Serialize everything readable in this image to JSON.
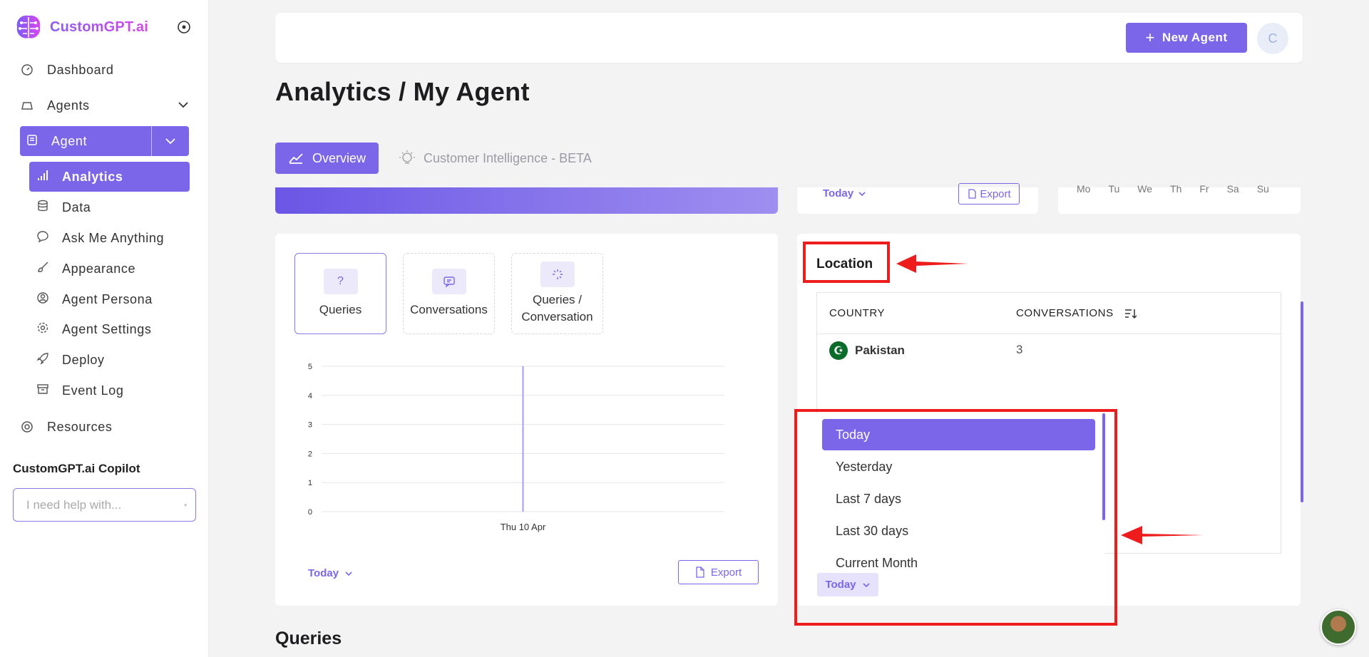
{
  "app": {
    "name": "CustomGPT.ai"
  },
  "sidebar": {
    "items": [
      {
        "label": "Dashboard",
        "icon": "dashboard-icon"
      },
      {
        "label": "Agents",
        "icon": "agents-icon"
      },
      {
        "label": "Agent",
        "icon": "agent-icon"
      },
      {
        "label": "Resources",
        "icon": "lifebuoy-icon"
      }
    ],
    "sub_items": [
      {
        "label": "Analytics",
        "icon": "bar-chart-icon"
      },
      {
        "label": "Data",
        "icon": "database-icon"
      },
      {
        "label": "Ask Me Anything",
        "icon": "chat-icon"
      },
      {
        "label": "Appearance",
        "icon": "brush-icon"
      },
      {
        "label": "Agent Persona",
        "icon": "user-circle-icon"
      },
      {
        "label": "Agent Settings",
        "icon": "gear-icon"
      },
      {
        "label": "Deploy",
        "icon": "rocket-icon"
      },
      {
        "label": "Event Log",
        "icon": "archive-icon"
      }
    ],
    "copilot": {
      "title": "CustomGPT.ai Copilot",
      "placeholder": "I need help with..."
    }
  },
  "header": {
    "new_agent_label": "New Agent",
    "avatar_initial": "C"
  },
  "page": {
    "title": "Analytics / My Agent"
  },
  "tabs": [
    {
      "label": "Overview",
      "active": true
    },
    {
      "label": "Customer Intelligence - BETA",
      "active": false
    }
  ],
  "top_cards": {
    "mid": {
      "range": "Today",
      "export": "Export"
    },
    "calendar_days": [
      "Mo",
      "Tu",
      "We",
      "Th",
      "Fr",
      "Sa",
      "Su"
    ]
  },
  "chart_card": {
    "metrics": [
      {
        "label": "Queries",
        "icon": "?"
      },
      {
        "label": "Conversations",
        "icon": "chat-icon"
      },
      {
        "label": "Queries / Conversation",
        "icon": "sparkle-icon"
      }
    ],
    "range": "Today",
    "export": "Export"
  },
  "chart_data": {
    "type": "line",
    "title": "",
    "xlabel": "",
    "ylabel": "",
    "x": [
      "Thu 10 Apr"
    ],
    "yticks": [
      0,
      1,
      2,
      3,
      4,
      5
    ],
    "ylim": [
      0,
      5
    ],
    "series": [
      {
        "values": [
          5
        ]
      }
    ],
    "grid": true,
    "color": "#a99bf2"
  },
  "location": {
    "title": "Location",
    "columns": [
      "COUNTRY",
      "CONVERSATIONS"
    ],
    "rows": [
      {
        "country": "Pakistan",
        "conversations": "3"
      }
    ],
    "range": "Today"
  },
  "dropdown": {
    "options": [
      "Today",
      "Yesterday",
      "Last 7 days",
      "Last 30 days",
      "Current Month"
    ],
    "selected": "Today"
  },
  "section": {
    "queries_title": "Queries"
  },
  "colors": {
    "accent": "#7b66ea",
    "annotation": "#ee1c1c"
  }
}
